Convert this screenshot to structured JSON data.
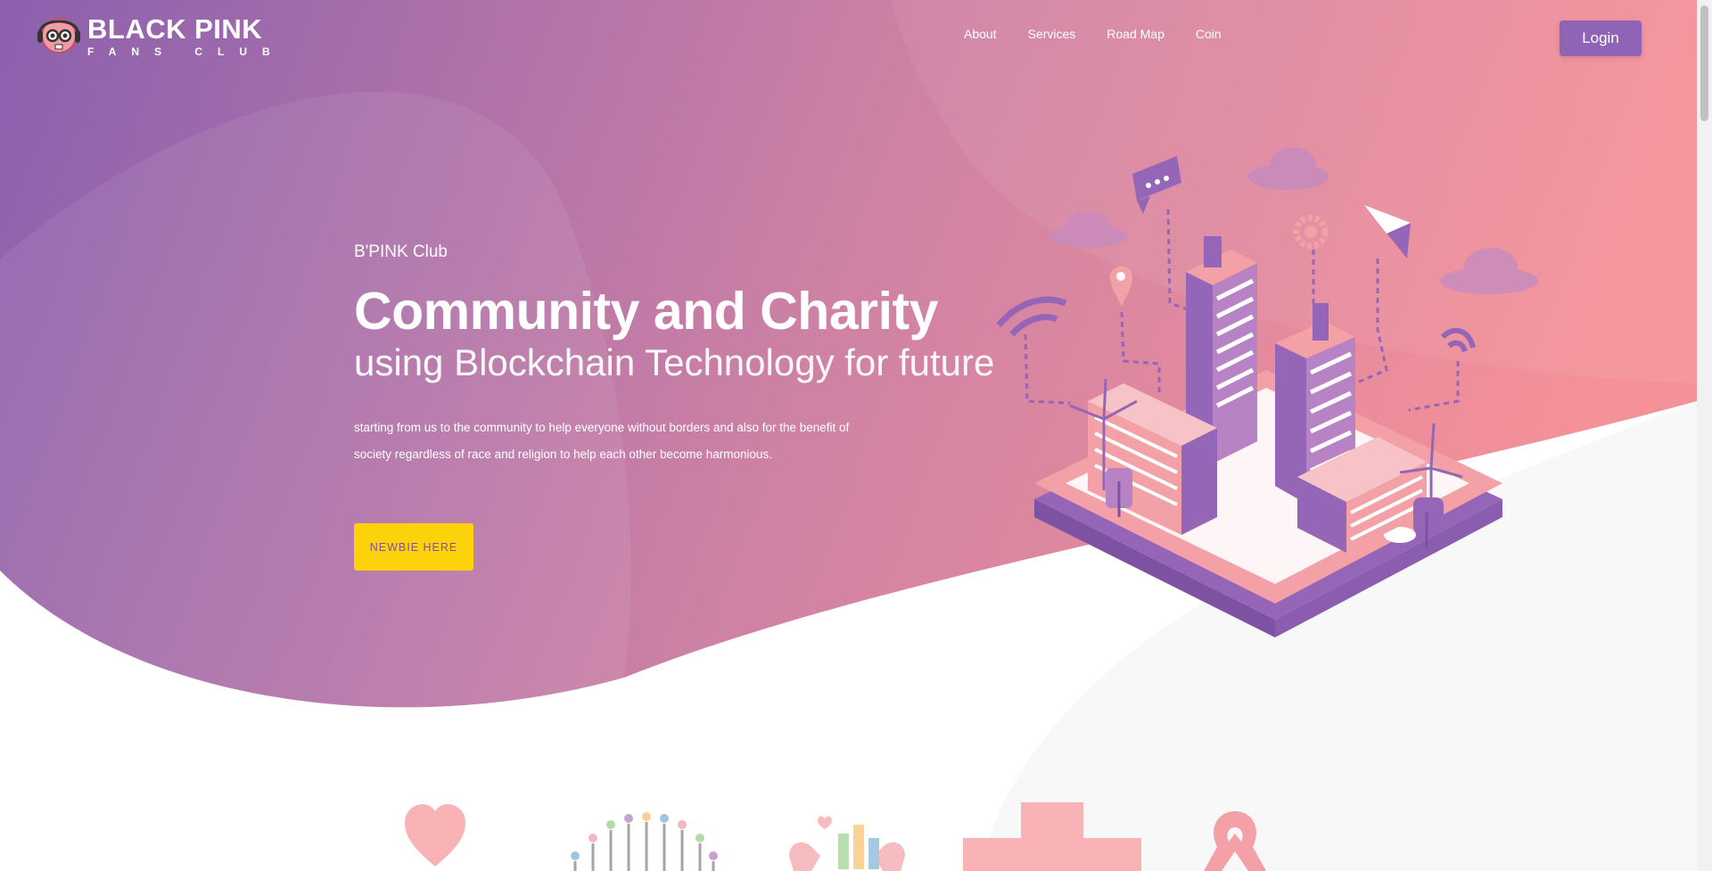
{
  "brand": {
    "title": "BLACK PINK",
    "subtitle": "FANS CLUB"
  },
  "nav": {
    "items": [
      "About",
      "Services",
      "Road Map",
      "Coin"
    ]
  },
  "header": {
    "login_label": "Login"
  },
  "hero": {
    "eyebrow": "B'PINK Club",
    "headline": "Community and Charity",
    "subheadline": "using Blockchain Technology for future",
    "description": "starting from us to the community to help everyone without borders and also for the benefit of society regardless of race and religion to help each other become harmonious.",
    "cta_label": "NEWBIE HERE"
  },
  "colors": {
    "gradient_start": "#8a5fb0",
    "gradient_end": "#f2919a",
    "accent_purple": "#8f63b6",
    "cta_yellow": "#fcd20a",
    "building_pink": "#f3a0a6",
    "building_purple": "#9566b7"
  },
  "features": {
    "icons": [
      "heart-icon",
      "community-people-icon",
      "charity-hands-icon",
      "medical-cross-icon",
      "awareness-ribbon-icon"
    ]
  }
}
